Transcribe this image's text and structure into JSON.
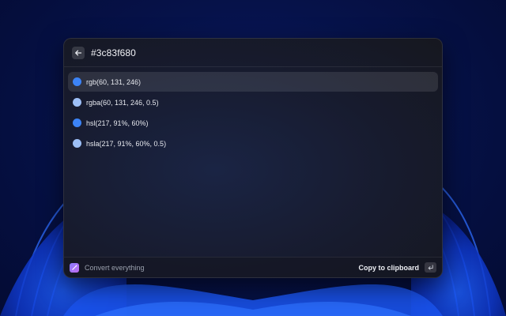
{
  "search": {
    "query": "#3c83f680"
  },
  "results": [
    {
      "label": "rgb(60, 131, 246)",
      "swatch_color": "#3c83f6",
      "selected": true
    },
    {
      "label": "rgba(60, 131, 246, 0.5)",
      "swatch_color": "#9dbff7",
      "selected": false
    },
    {
      "label": "hsl(217, 91%, 60%)",
      "swatch_color": "#3c83f6",
      "selected": false
    },
    {
      "label": "hsla(217, 91%, 60%, 0.5)",
      "swatch_color": "#9dbff7",
      "selected": false
    }
  ],
  "footer": {
    "command_title": "Convert everything",
    "primary_action": "Copy to clipboard",
    "app_icon": "magic-wand-icon",
    "shortcut_icon": "enter-key-icon"
  },
  "colors": {
    "accent": "#3c83f6",
    "accent_half": "#9dbff7"
  }
}
